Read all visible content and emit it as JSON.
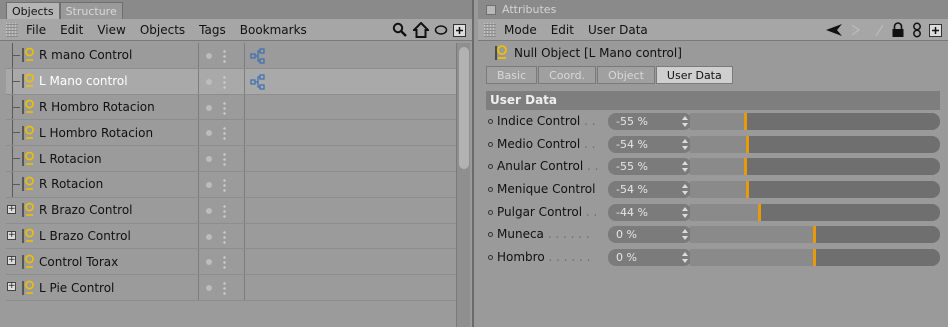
{
  "left_panel": {
    "tabs": [
      "Objects",
      "Structure"
    ],
    "menu": [
      "File",
      "Edit",
      "View",
      "Objects",
      "Tags",
      "Bookmarks"
    ],
    "objects": [
      {
        "name": "R mano Control",
        "expandable": false,
        "selected": false,
        "has_tag": true
      },
      {
        "name": "L Mano control",
        "expandable": false,
        "selected": true,
        "has_tag": true
      },
      {
        "name": "R Hombro Rotacion",
        "expandable": false,
        "selected": false,
        "has_tag": false
      },
      {
        "name": "L Hombro Rotacion",
        "expandable": false,
        "selected": false,
        "has_tag": false
      },
      {
        "name": "L Rotacion",
        "expandable": false,
        "selected": false,
        "has_tag": false
      },
      {
        "name": "R Rotacion",
        "expandable": false,
        "selected": false,
        "has_tag": false
      },
      {
        "name": "R Brazo Control",
        "expandable": true,
        "selected": false,
        "has_tag": false
      },
      {
        "name": "L Brazo Control",
        "expandable": true,
        "selected": false,
        "has_tag": false
      },
      {
        "name": "Control Torax",
        "expandable": true,
        "selected": false,
        "has_tag": false
      },
      {
        "name": "L Pie Control",
        "expandable": true,
        "selected": false,
        "has_tag": false
      }
    ]
  },
  "right_panel": {
    "title": "Attributes",
    "menu": [
      "Mode",
      "Edit",
      "User Data"
    ],
    "object_label": "Null Object [L Mano control]",
    "tabs": [
      "Basic",
      "Coord.",
      "Object",
      "User Data"
    ],
    "active_tab": "User Data",
    "section_title": "User Data",
    "params": [
      {
        "label": "Indice Control",
        "dots": " . .",
        "value": "-55 %",
        "percent": -55
      },
      {
        "label": "Medio Control",
        "dots": " . .",
        "value": "-54 %",
        "percent": -54
      },
      {
        "label": "Anular Control",
        "dots": " . .",
        "value": "-55 %",
        "percent": -55
      },
      {
        "label": "Menique Control",
        "dots": "",
        "value": "-54 %",
        "percent": -54
      },
      {
        "label": "Pulgar Control",
        "dots": " . .",
        "value": "-44 %",
        "percent": -44
      },
      {
        "label": "Muneca",
        "dots": " . . . . . .",
        "value": "0 %",
        "percent": 0
      },
      {
        "label": "Hombro",
        "dots": " . . . . . .",
        "value": "0 %",
        "percent": 0
      }
    ]
  },
  "colors": {
    "slider_knob": "#e89a0a",
    "selected_text": "#ffffff",
    "null_icon": "#f0c000"
  }
}
